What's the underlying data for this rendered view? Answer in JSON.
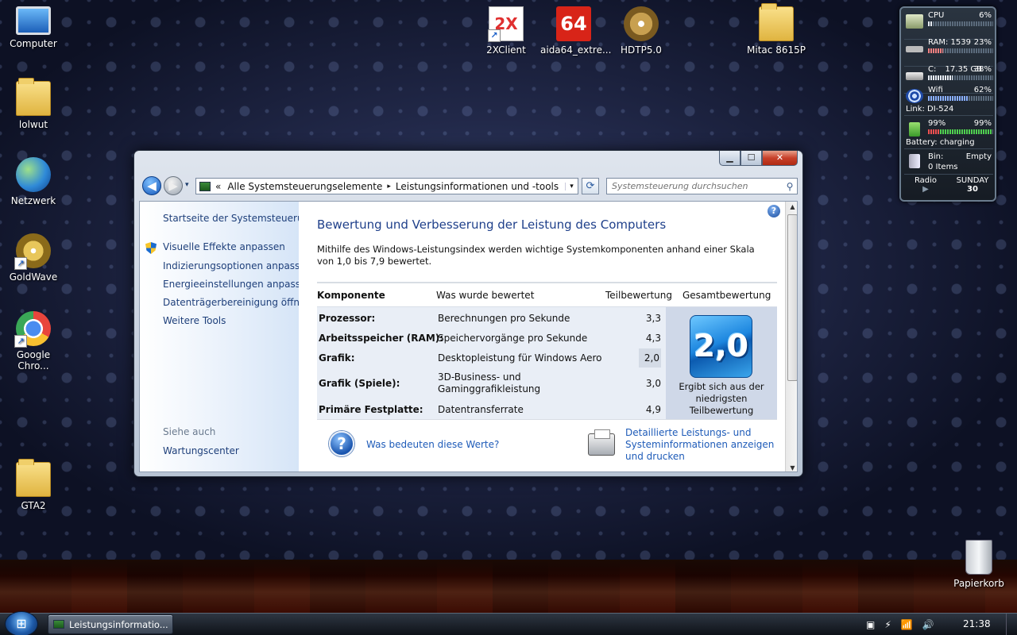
{
  "desktop": {
    "icons": [
      {
        "label": "Computer"
      },
      {
        "label": "lolwut"
      },
      {
        "label": "Netzwerk"
      },
      {
        "label": "GoldWave"
      },
      {
        "label": "Google Chro..."
      },
      {
        "label": "GTA2"
      },
      {
        "label": "2XClient"
      },
      {
        "label": "aida64_extre..."
      },
      {
        "label": "HDTP5.0"
      },
      {
        "label": "Mitac 8615P"
      },
      {
        "label": "Papierkorb"
      }
    ],
    "icon_glyphs": {
      "twox": "2X",
      "aida": "64"
    }
  },
  "gadget": {
    "cpu": {
      "label": "CPU",
      "value": "6%",
      "fill": 0.06
    },
    "ram": {
      "label": "RAM: 1539",
      "value": "23%",
      "fill": 0.23
    },
    "disk": {
      "label": "C:",
      "detail": "17.35 GB",
      "value": "38%",
      "fill": 0.38
    },
    "wifi": {
      "label": "Wifi",
      "value": "62%",
      "link": "Link: DI-524",
      "fill": 0.62
    },
    "battery": {
      "left": "99%",
      "right": "99%",
      "status": "Battery: charging",
      "fill": 0.99
    },
    "bin": {
      "label": "Bin:",
      "state": "Empty",
      "items": "0 Items"
    },
    "radio": {
      "label": "Radio"
    },
    "day": {
      "label": "SUNDAY",
      "date": "30"
    }
  },
  "window": {
    "controls": {
      "minimize": "▁",
      "maximize": "☐",
      "close": "✕"
    },
    "nav": {
      "back": "◀",
      "forward": "▶",
      "history": "▾"
    },
    "address": {
      "chevron": "«",
      "crumb1": "Alle Systemsteuerungselemente",
      "sep": "▸",
      "crumb2": "Leistungsinformationen und -tools",
      "dropdown": "▾",
      "refresh": "⟳"
    },
    "search_placeholder": "Systemsteuerung durchsuchen",
    "search_icon": "⚲",
    "sidebar": {
      "home": "Startseite der Systemsteuerung",
      "links": [
        "Visuelle Effekte anpassen",
        "Indizierungsoptionen anpassen",
        "Energieeinstellungen anpassen",
        "Datenträgerbereinigung öffnen",
        "Weitere Tools"
      ],
      "see_also": "Siehe auch",
      "see_also_links": [
        "Wartungscenter"
      ]
    },
    "main": {
      "help": "?",
      "title": "Bewertung und Verbesserung der Leistung des Computers",
      "description": "Mithilfe des Windows-Leistungsindex werden wichtige Systemkomponenten anhand einer Skala von 1,0 bis 7,9 bewertet.",
      "columns": [
        "Komponente",
        "Was wurde bewertet",
        "Teilbewertung",
        "Gesamtbewertung"
      ],
      "rows": [
        {
          "component": "Prozessor:",
          "rated": "Berechnungen pro Sekunde",
          "score": "3,3"
        },
        {
          "component": "Arbeitsspeicher (RAM):",
          "rated": "Speichervorgänge pro Sekunde",
          "score": "4,3"
        },
        {
          "component": "Grafik:",
          "rated": "Desktopleistung für Windows Aero",
          "score": "2,0"
        },
        {
          "component": "Grafik (Spiele):",
          "rated": "3D-Business- und Gaminggrafikleistung",
          "score": "3,0"
        },
        {
          "component": "Primäre Festplatte:",
          "rated": "Datentransferrate",
          "score": "4,9"
        }
      ],
      "base_score": "2,0",
      "base_score_note": "Ergibt sich aus der niedrigsten Teilbewertung",
      "help_link": "Was bedeuten diese Werte?",
      "print_link": "Detaillierte Leistungs- und Systeminformationen anzeigen und drucken"
    },
    "scroll": {
      "up": "▲",
      "down": "▼"
    }
  },
  "taskbar": {
    "start_glyph": "⊞",
    "task_title": "Leistungsinformatio...",
    "tray_icons": [
      "▣",
      "⚡",
      "📶",
      "🔊"
    ],
    "clock": "21:38"
  }
}
